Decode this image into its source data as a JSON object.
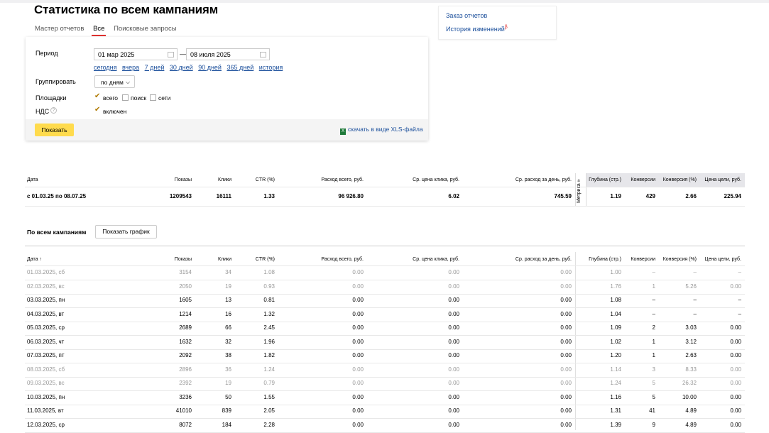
{
  "page": {
    "title": "Статистика по всем кампаниям",
    "tabs": [
      {
        "label": "Мастер отчетов",
        "active": false
      },
      {
        "label": "Все",
        "active": true
      },
      {
        "label": "Поисковые запросы",
        "active": false
      }
    ]
  },
  "side_links": {
    "order_reports": "Заказ отчетов",
    "change_history": "История изменений",
    "change_history_badge": "β"
  },
  "form": {
    "period_label": "Период",
    "date_from": "01 мар 2025",
    "date_separator": "—",
    "date_to": "08 июля 2025",
    "quick_ranges": [
      "сегодня",
      "вчера",
      "7 дней",
      "30 дней",
      "90 дней",
      "365 дней",
      "история"
    ],
    "group_label": "Группировать",
    "group_value": "по дням",
    "platforms_label": "Площадки",
    "platforms": [
      {
        "label": "всего",
        "checked": true
      },
      {
        "label": "поиск",
        "checked": false
      },
      {
        "label": "сети",
        "checked": false
      }
    ],
    "vat_label": "НДС",
    "vat_option": {
      "label": "включен",
      "checked": true
    },
    "show_button": "Показать",
    "download_link": "скачать в виде XLS-файла"
  },
  "summary": {
    "headers": [
      "Дата",
      "Показы",
      "Клики",
      "CTR (%)",
      "Расход всего, руб.",
      "Ср. цена клика, руб.",
      "Ср. расход за день, руб.",
      "Глубина (стр.)",
      "Конверсии",
      "Конверсия (%)",
      "Цена цели, руб."
    ],
    "metrika_label": "Метрика »",
    "row": [
      "с 01.03.25 по 08.07.25",
      "1209543",
      "16111",
      "1.33",
      "96 926.80",
      "6.02",
      "745.59",
      "1.19",
      "429",
      "2.66",
      "225.94"
    ]
  },
  "daily": {
    "section_title": "По всем кампаниям",
    "graph_button": "Показать график",
    "headers": [
      "Дата ↑",
      "Показы",
      "Клики",
      "CTR (%)",
      "Расход всего, руб.",
      "Ср. цена клика, руб.",
      "Ср. расход за день, руб.",
      "Глубина (стр.)",
      "Конверсии",
      "Конверсия (%)",
      "Цена цели, руб."
    ],
    "rows": [
      {
        "muted": true,
        "cells": [
          "01.03.2025, сб",
          "3154",
          "34",
          "1.08",
          "0.00",
          "0.00",
          "0.00",
          "1.00",
          "–",
          "–",
          "–"
        ]
      },
      {
        "muted": true,
        "cells": [
          "02.03.2025, вс",
          "2050",
          "19",
          "0.93",
          "0.00",
          "0.00",
          "0.00",
          "1.76",
          "1",
          "5.26",
          "0.00"
        ]
      },
      {
        "muted": false,
        "cells": [
          "03.03.2025, пн",
          "1605",
          "13",
          "0.81",
          "0.00",
          "0.00",
          "0.00",
          "1.08",
          "–",
          "–",
          "–"
        ]
      },
      {
        "muted": false,
        "cells": [
          "04.03.2025, вт",
          "1214",
          "16",
          "1.32",
          "0.00",
          "0.00",
          "0.00",
          "1.04",
          "–",
          "–",
          "–"
        ]
      },
      {
        "muted": false,
        "cells": [
          "05.03.2025, ср",
          "2689",
          "66",
          "2.45",
          "0.00",
          "0.00",
          "0.00",
          "1.09",
          "2",
          "3.03",
          "0.00"
        ]
      },
      {
        "muted": false,
        "cells": [
          "06.03.2025, чт",
          "1632",
          "32",
          "1.96",
          "0.00",
          "0.00",
          "0.00",
          "1.02",
          "1",
          "3.12",
          "0.00"
        ]
      },
      {
        "muted": false,
        "cells": [
          "07.03.2025, пт",
          "2092",
          "38",
          "1.82",
          "0.00",
          "0.00",
          "0.00",
          "1.20",
          "1",
          "2.63",
          "0.00"
        ]
      },
      {
        "muted": true,
        "cells": [
          "08.03.2025, сб",
          "2896",
          "36",
          "1.24",
          "0.00",
          "0.00",
          "0.00",
          "1.14",
          "3",
          "8.33",
          "0.00"
        ]
      },
      {
        "muted": true,
        "cells": [
          "09.03.2025, вс",
          "2392",
          "19",
          "0.79",
          "0.00",
          "0.00",
          "0.00",
          "1.24",
          "5",
          "26.32",
          "0.00"
        ]
      },
      {
        "muted": false,
        "cells": [
          "10.03.2025, пн",
          "3236",
          "50",
          "1.55",
          "0.00",
          "0.00",
          "0.00",
          "1.16",
          "5",
          "10.00",
          "0.00"
        ]
      },
      {
        "muted": false,
        "cells": [
          "11.03.2025, вт",
          "41010",
          "839",
          "2.05",
          "0.00",
          "0.00",
          "0.00",
          "1.31",
          "41",
          "4.89",
          "0.00"
        ]
      },
      {
        "muted": false,
        "cells": [
          "12.03.2025, ср",
          "8072",
          "184",
          "2.28",
          "0.00",
          "0.00",
          "0.00",
          "1.39",
          "9",
          "4.89",
          "0.00"
        ]
      }
    ]
  }
}
